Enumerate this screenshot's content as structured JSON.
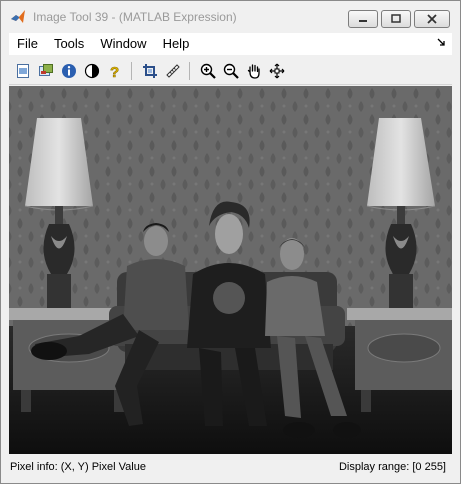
{
  "window": {
    "title": "Image Tool 39 - (MATLAB Expression)"
  },
  "menu": {
    "items": [
      "File",
      "Tools",
      "Window",
      "Help"
    ],
    "overflow_icon": "arrow-down-right-icon"
  },
  "toolbar": {
    "buttons": [
      "new-figure-icon",
      "image-info-icon",
      "info-icon",
      "contrast-icon",
      "help-icon",
      "crop-icon",
      "measure-distance-icon",
      "zoom-in-icon",
      "zoom-out-icon",
      "pan-hand-icon",
      "pixel-region-icon"
    ]
  },
  "image": {
    "description_colors": {
      "wallpaper": "#6e6e6e",
      "floor": "#141414"
    }
  },
  "status": {
    "pixel_info": "Pixel info: (X, Y)  Pixel Value",
    "display_range": "Display range: [0 255]"
  }
}
